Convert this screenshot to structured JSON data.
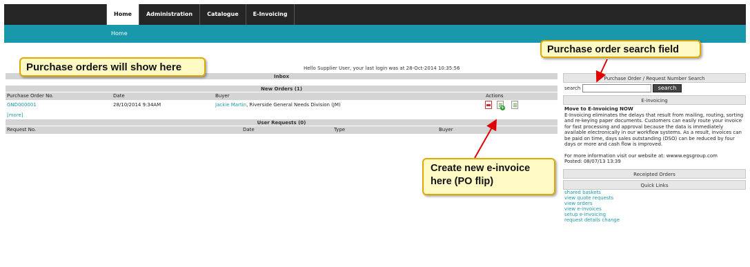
{
  "nav": {
    "tabs": [
      {
        "label": "Home",
        "active": true
      },
      {
        "label": "Administration",
        "active": false
      },
      {
        "label": "Catalogue",
        "active": false
      },
      {
        "label": "E-Invoicing",
        "active": false
      }
    ],
    "breadcrumb": "Home"
  },
  "greeting": "Hello Supplier User, your last login was at 28-Oct-2014 10:35:56",
  "inbox": {
    "title": "Inbox",
    "new_orders": {
      "heading": "New Orders (1)",
      "columns": [
        "Purchase Order No.",
        "Date",
        "Buyer",
        "Actions"
      ],
      "rows": [
        {
          "po": "GND000001",
          "date": "28/10/2014 9:34AM",
          "buyer_link": "Jackie Martin",
          "buyer_rest": ", Riverside General Needs Division (JM)"
        }
      ],
      "more": "[more]"
    },
    "user_requests": {
      "heading": "User Requests (0)",
      "columns": [
        "Request No.",
        "Date",
        "Type",
        "Buyer"
      ]
    }
  },
  "sidebar": {
    "search_heading": "Purchase Order / Request Number Search",
    "search_label": "search",
    "search_button": "search",
    "einvoicing_heading": "E-invoicing",
    "einvoicing_title": "Move to E-Invoicing NOW",
    "einvoicing_body": "E-Invoicing eliminates the delays that result from mailing, routing, sorting and re-keying paper documents. Customers can easily route your invoice for fast processing and approval because the data is immediately available electronically in our workflow systems. As a result, invoices can be paid on time, days sales outstanding (DSO) can be reduced by four days or more and cash flow is improved.",
    "einvoicing_more": "For more information visit our website at: wwww.egsgroup.com",
    "einvoicing_posted": "Posted: 08/07/13 13:39",
    "receipted_heading": "Receipted Orders",
    "quick_heading": "Quick Links",
    "quick_links": [
      "shared baskets",
      "view quote requests",
      "view orders",
      "view e-invoices",
      "setup e-invoicing",
      "request details change"
    ]
  },
  "callouts": {
    "purchase_orders": "Purchase orders will show here",
    "search_field": "Purchase order search field",
    "create_invoice": "Create new e-invoice here (PO flip)"
  },
  "colors": {
    "topbar": "#262626",
    "accent": "#1a98ab",
    "callout_bg": "#fff9c4",
    "callout_border": "#e0a800",
    "arrow": "#e00000"
  },
  "icons": [
    "pdf-icon",
    "create-invoice-icon",
    "document-icon"
  ]
}
